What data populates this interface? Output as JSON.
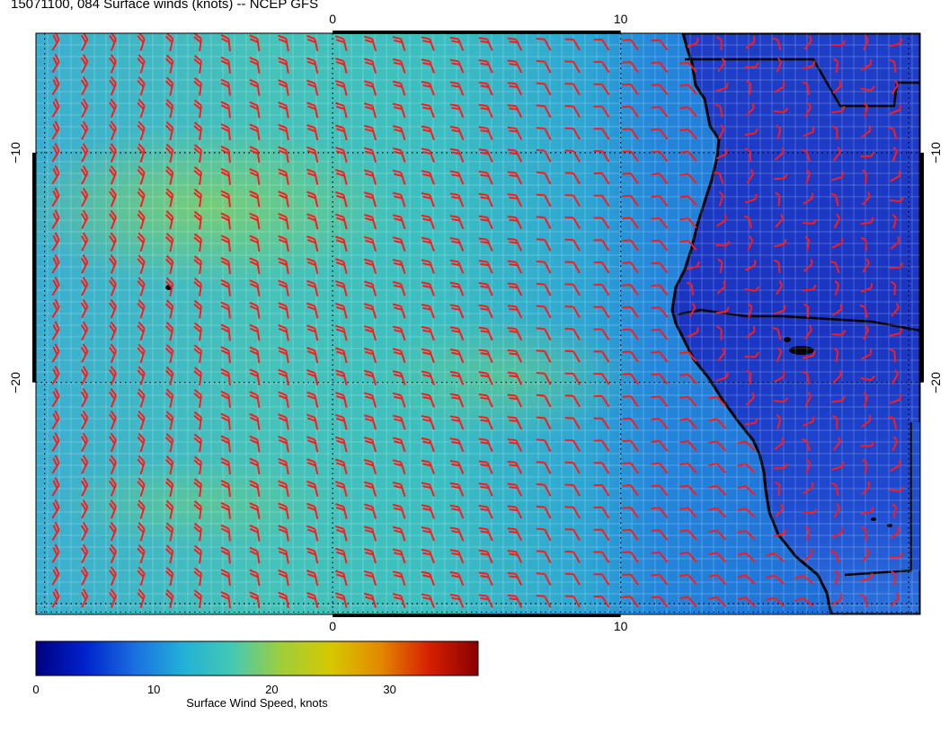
{
  "title": "15071100, 084 Surface winds (knots) -- NCEP GFS",
  "map": {
    "longitude_ticks": [
      {
        "value": 0,
        "label": "0"
      },
      {
        "value": 10,
        "label": "10"
      }
    ],
    "latitude_ticks": [
      {
        "value": -10,
        "label": "−10"
      },
      {
        "value": -20,
        "label": "−20"
      }
    ],
    "extent": {
      "lon_min": -10.3,
      "lon_max": 20.4,
      "lat_min": -30.1,
      "lat_max": -4.8
    },
    "barb_color": "#ff1a1a",
    "coastline_color": "#000000"
  },
  "colorbar": {
    "title": "Surface Wind Speed, knots",
    "ticks": [
      {
        "value": 0,
        "label": "0"
      },
      {
        "value": 10,
        "label": "10"
      },
      {
        "value": 20,
        "label": "20"
      },
      {
        "value": 30,
        "label": "30"
      }
    ],
    "range": [
      0,
      37.5
    ],
    "stops": [
      "#000080",
      "#0022cc",
      "#1a6ee0",
      "#23b0d8",
      "#44c9b3",
      "#9fce3a",
      "#d7c800",
      "#e28a00",
      "#d62000",
      "#8a0000"
    ]
  }
}
